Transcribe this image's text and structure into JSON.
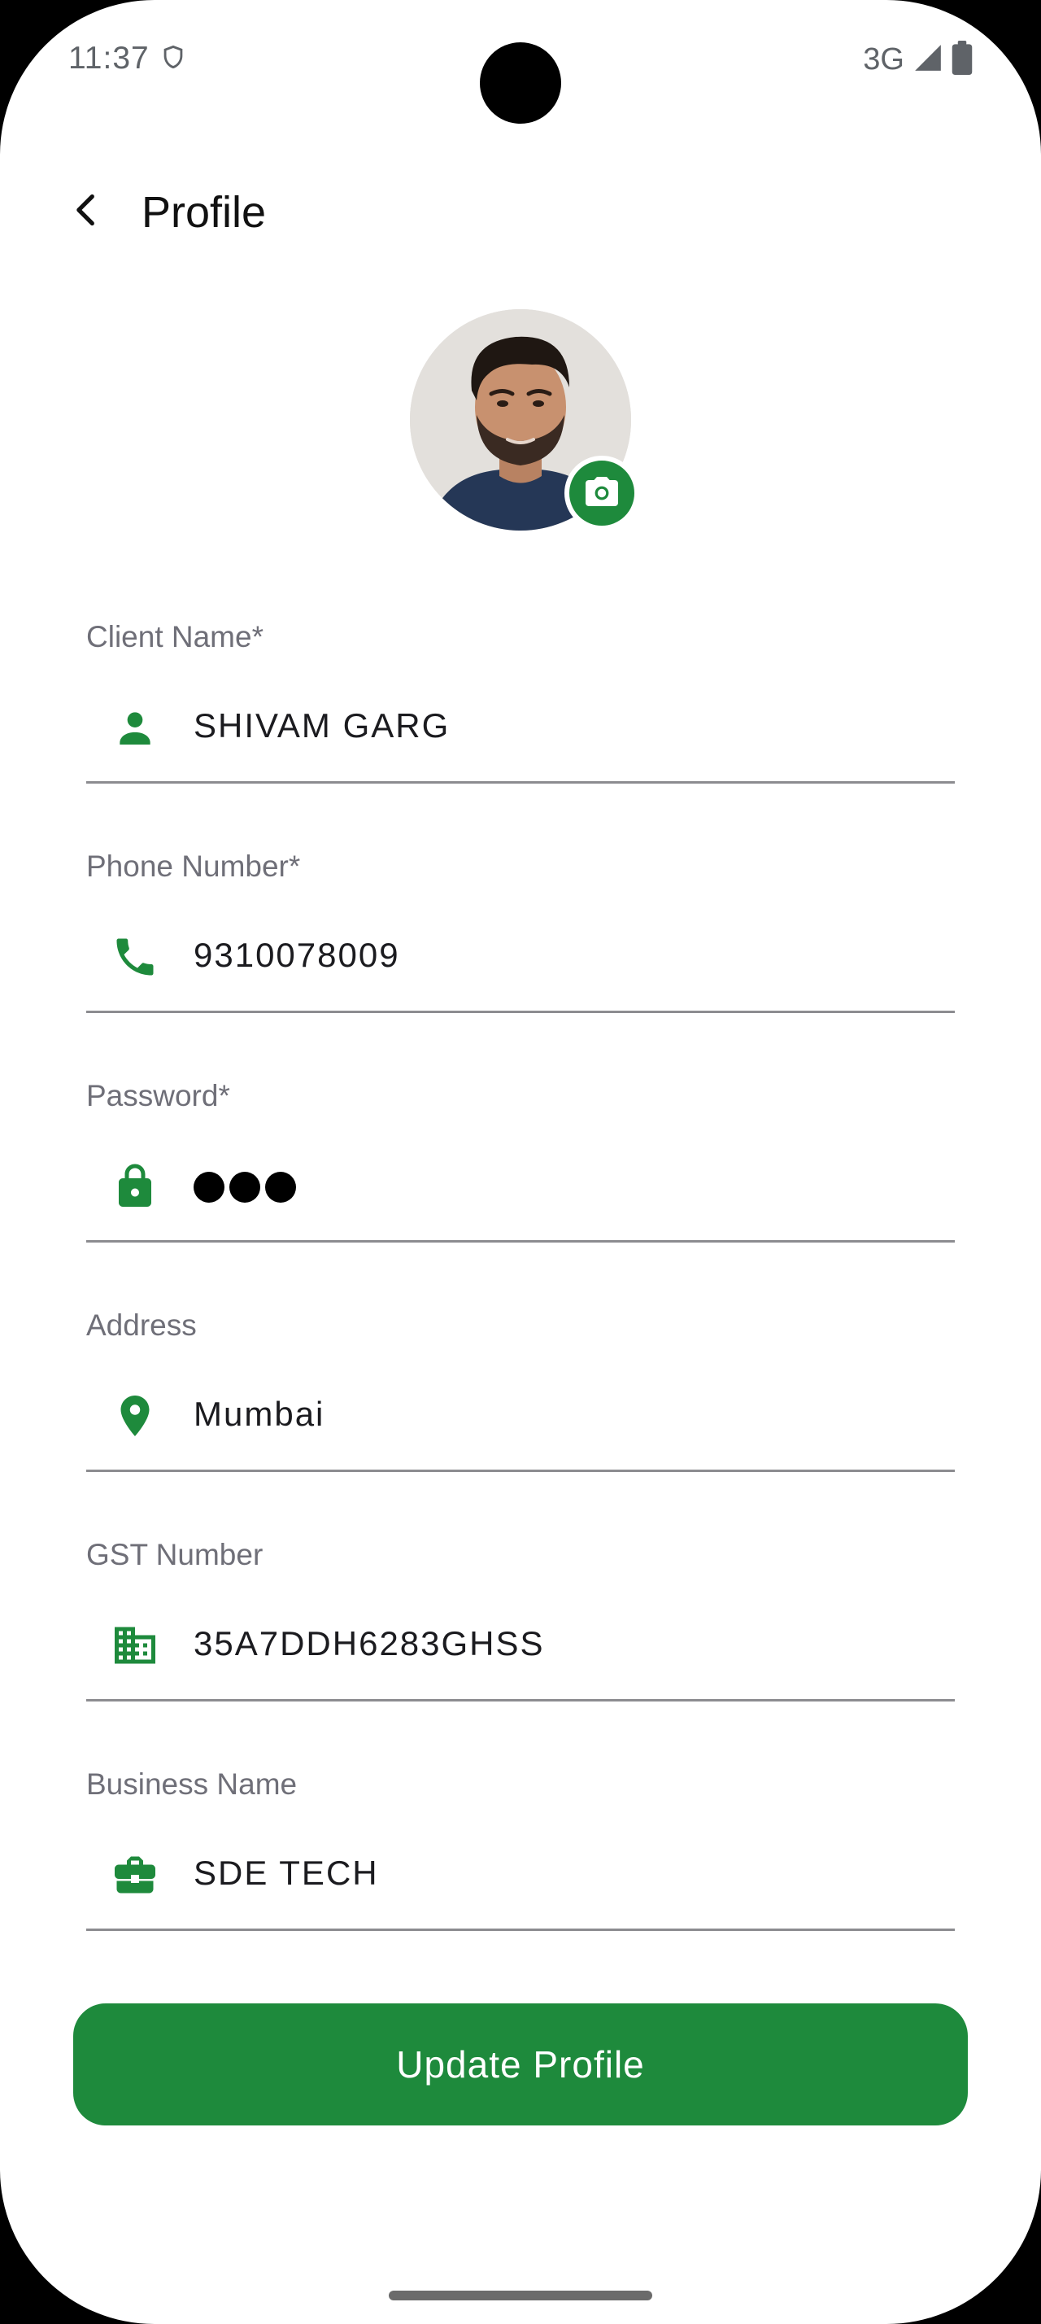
{
  "status_bar": {
    "time": "11:37",
    "network": "3G"
  },
  "header": {
    "title": "Profile"
  },
  "fields": [
    {
      "label": "Client Name*",
      "value": "SHIVAM GARG",
      "icon": "person-icon"
    },
    {
      "label": "Phone Number*",
      "value": "9310078009",
      "icon": "phone-icon"
    },
    {
      "label": "Password*",
      "value": "",
      "icon": "lock-icon",
      "masked_length": 3
    },
    {
      "label": "Address",
      "value": "Mumbai",
      "icon": "location-pin-icon"
    },
    {
      "label": "GST Number",
      "value": "35A7DDH6283GHSS",
      "icon": "building-icon"
    },
    {
      "label": "Business Name",
      "value": "SDE TECH",
      "icon": "briefcase-icon"
    }
  ],
  "actions": {
    "update_label": "Update Profile"
  },
  "colors": {
    "accent": "#1e8a3c",
    "label": "#6f6f78",
    "text": "#1b1b1f"
  }
}
